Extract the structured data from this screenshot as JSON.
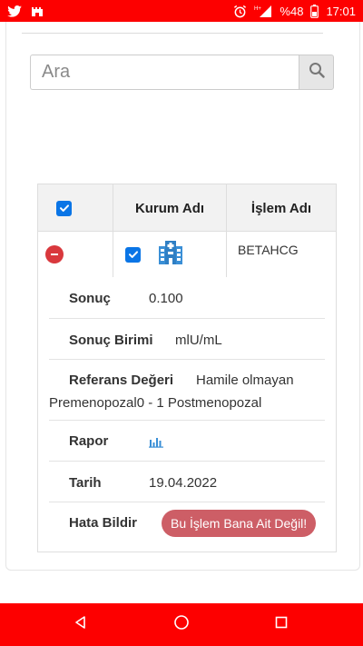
{
  "status_bar": {
    "battery": "%48",
    "time": "17:01",
    "network": "H+",
    "icons": [
      "twitter-icon",
      "castle-icon",
      "alarm-icon",
      "signal-icon",
      "battery-icon"
    ]
  },
  "search": {
    "placeholder": "Ara",
    "button_icon": "search-icon"
  },
  "table": {
    "headers": {
      "kurum": "Kurum Adı",
      "islem": "İşlem Adı"
    },
    "row": {
      "islem_adi": "BETAHCG",
      "kurum_icon": "hospital-building-icon"
    }
  },
  "details": {
    "sonuc_label": "Sonuç",
    "sonuc_value": "0.100",
    "birim_label": "Sonuç Birimi",
    "birim_value": "mlU/mL",
    "referans_label": "Referans Değeri",
    "referans_value_line1": "Hamile olmayan",
    "referans_value_line2": "Premenopozal0 - 1 Postmenopozal",
    "rapor_label": "Rapor",
    "rapor_icon": "bar-chart-icon",
    "tarih_label": "Tarih",
    "tarih_value": "19.04.2022",
    "hata_label": "Hata Bildir",
    "hata_button": "Bu İşlem Bana Ait Değil!"
  },
  "colors": {
    "status_bar": "#fd0000",
    "checkbox": "#0a75e6",
    "minus": "#d9383d",
    "hata_button": "#cd5e66",
    "chart_icon": "#3a8fd6"
  }
}
